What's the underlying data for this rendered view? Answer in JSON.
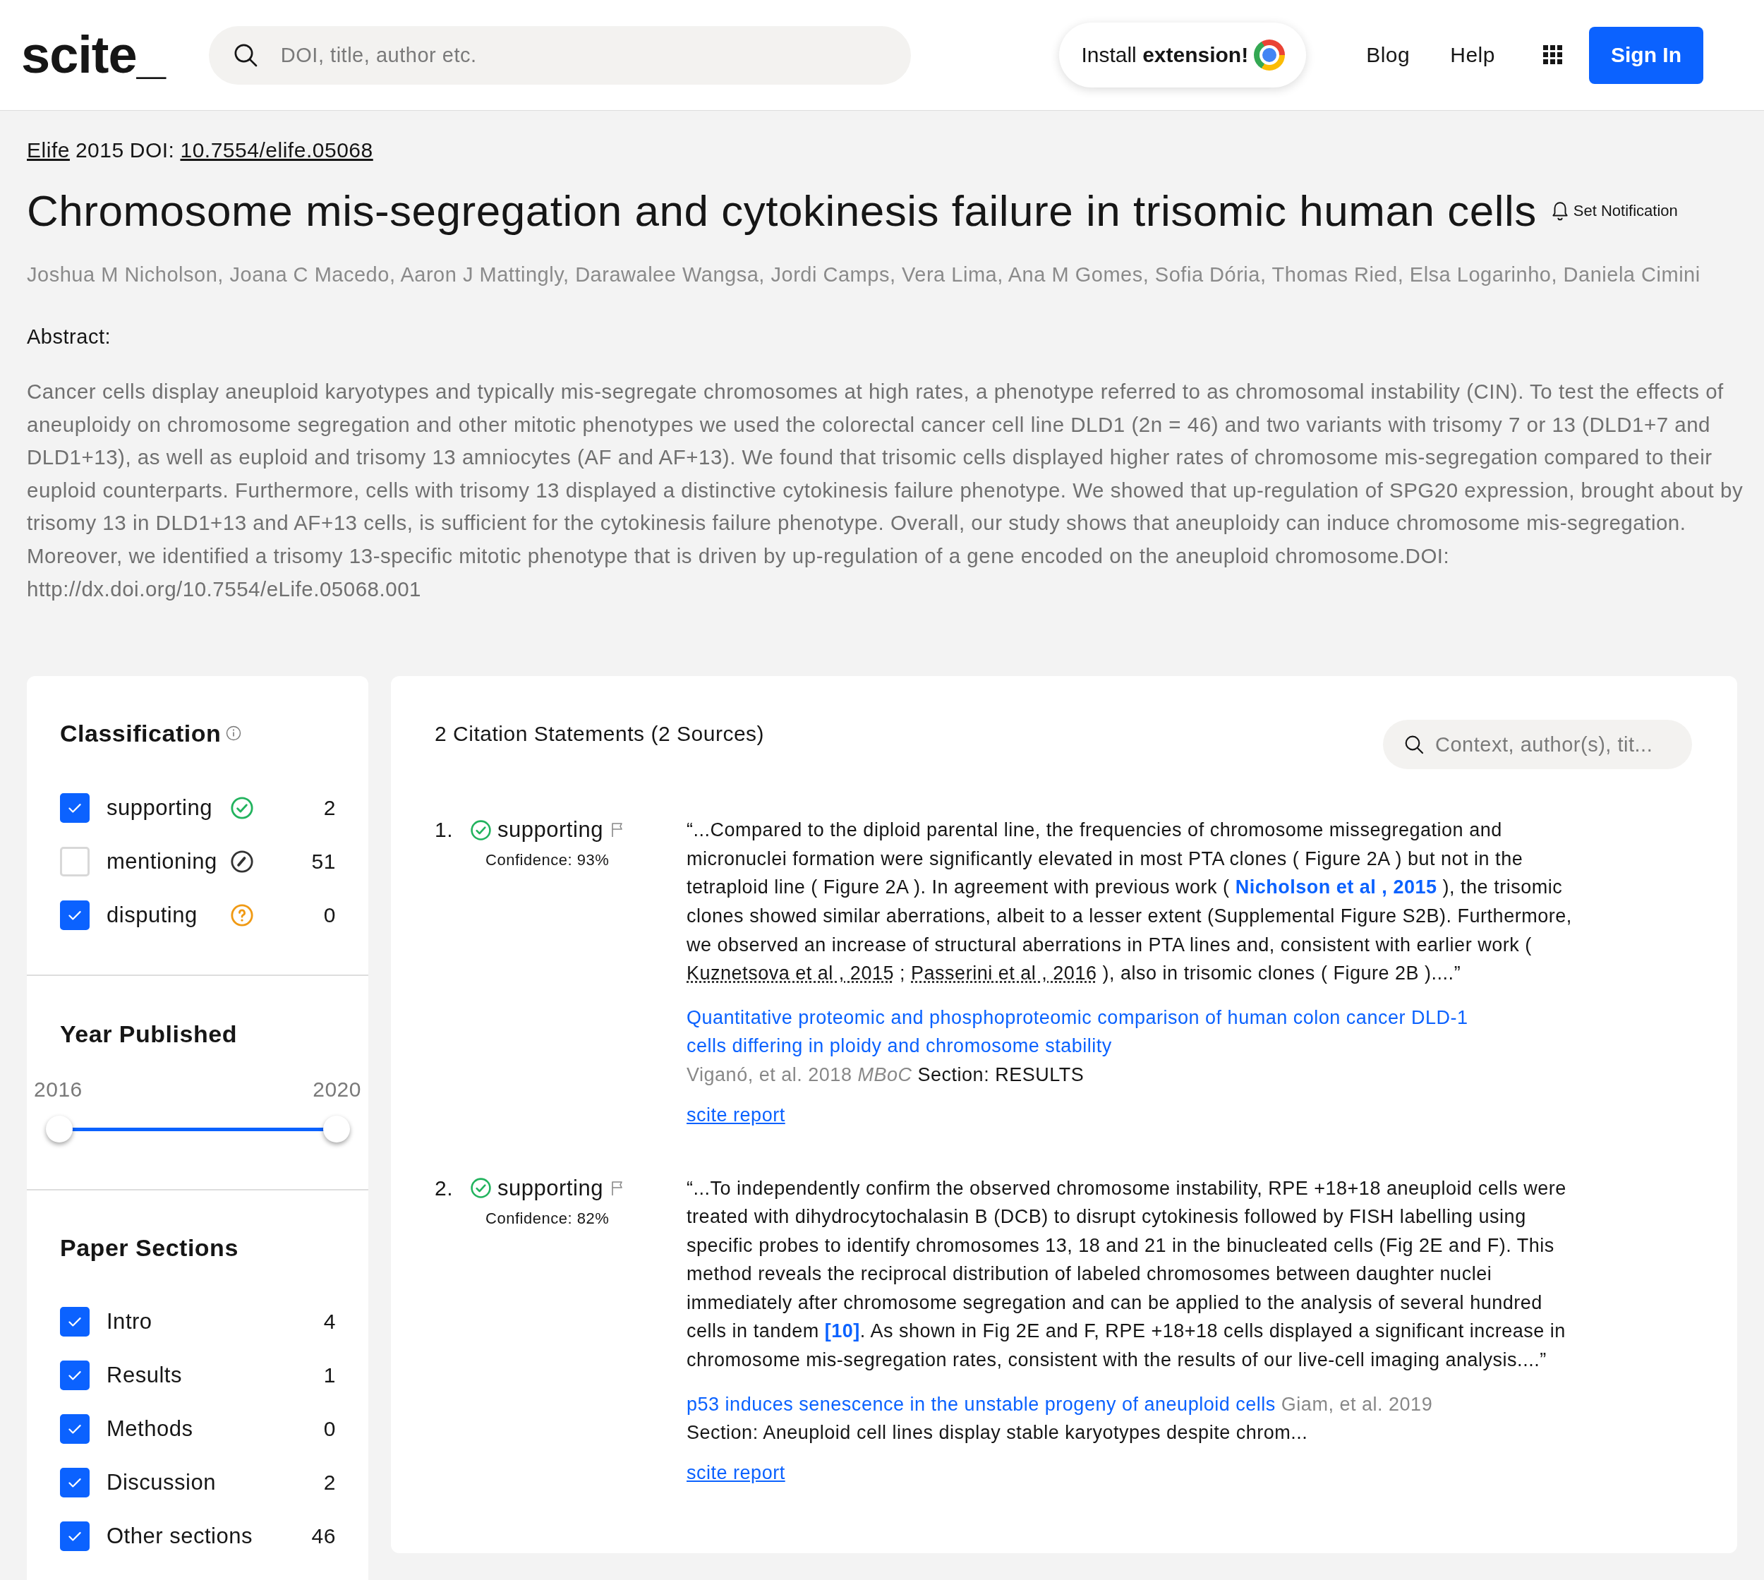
{
  "header": {
    "logo": "scite_",
    "search": {
      "placeholder": "DOI, title, author etc."
    },
    "install_button": "Install **extension!**",
    "nav": [
      "Blog",
      "Help"
    ],
    "sign_in": "Sign In"
  },
  "paper": {
    "journal_link": "Elife",
    "year": "2015",
    "doi_label": "DOI:",
    "doi_link": "10.7554/elife.05068",
    "title": "Chromosome mis-segregation and cytokinesis failure in trisomic human cells",
    "notification": "Set Notification",
    "authors": "Joshua M Nicholson, Joana C Macedo, Aaron J Mattingly, Darawalee Wangsa, Jordi Camps, Vera Lima, Ana M Gomes, Sofia Dória, Thomas Ried, Elsa Logarinho, Daniela Cimini",
    "abstract_label": "Abstract:",
    "abstract": "Cancer cells display aneuploid karyotypes and typically mis-segregate chromosomes at high rates, a phenotype referred to as chromosomal instability (CIN). To test the effects of aneuploidy on chromosome segregation and other mitotic phenotypes we used the colorectal cancer cell line DLD1 (2n = 46) and two variants with trisomy 7 or 13 (DLD1+7 and DLD1+13), as well as euploid and trisomy 13 amniocytes (AF and AF+13). We found that trisomic cells displayed higher rates of chromosome mis-segregation compared to their euploid counterparts. Furthermore, cells with trisomy 13 displayed a distinctive cytokinesis failure phenotype. We showed that up-regulation of SPG20 expression, brought about by trisomy 13 in DLD1+13 and AF+13 cells, is sufficient for the cytokinesis failure phenotype. Overall, our study shows that aneuploidy can induce chromosome mis-segregation. Moreover, we identified a trisomy 13-specific mitotic phenotype that is driven by up-regulation of a gene encoded on the aneuploid chromosome.DOI: http://dx.doi.org/10.7554/eLife.05068.001"
  },
  "filters": {
    "classification": {
      "title": "Classification",
      "items": [
        {
          "label": "supporting",
          "kind": "supporting",
          "checked": true,
          "count": "2"
        },
        {
          "label": "mentioning",
          "kind": "mentioning",
          "checked": false,
          "count": "51"
        },
        {
          "label": "disputing",
          "kind": "disputing",
          "checked": true,
          "count": "0"
        }
      ]
    },
    "year": {
      "title": "Year Published",
      "min_label": "2016",
      "max_label": "2020",
      "thumbs": [
        {
          "level": 0
        },
        {
          "level": 1
        }
      ]
    },
    "sections": {
      "title": "Paper Sections",
      "items": [
        {
          "label": "Intro",
          "checked": true,
          "count": "4"
        },
        {
          "label": "Results",
          "checked": true,
          "count": "1"
        },
        {
          "label": "Methods",
          "checked": true,
          "count": "0"
        },
        {
          "label": "Discussion",
          "checked": true,
          "count": "2"
        },
        {
          "label": "Other sections",
          "checked": true,
          "count": "46"
        }
      ]
    }
  },
  "citations": {
    "heading": "2 Citation Statements (2 Sources)",
    "search": {
      "placeholder": "Context, author(s), tit..."
    },
    "items": [
      {
        "number": "1.",
        "kind": "supporting",
        "label": "supporting",
        "confidence": "Confidence: 93%",
        "quote": [
          {
            "kind": "text",
            "text": "“...Compared to the diploid parental line, the frequencies of chromosome missegregation and micronuclei formation were significantly elevated in most PTA clones ( Figure 2A ) but not in the tetraploid line ( Figure 2A ). In agreement with previous work ( "
          },
          {
            "kind": "bold-link",
            "text": "Nicholson et al , 2015"
          },
          {
            "kind": "text",
            "text": " ), the trisomic clones showed similar aberrations, albeit to a lesser extent (Supplemental Figure S2B). Furthermore, we observed an increase of structural aberrations in PTA lines and, consistent with earlier work ( "
          },
          {
            "kind": "ref-link",
            "text": "Kuznetsova et al , 2015"
          },
          {
            "kind": "text",
            "text": " ; "
          },
          {
            "kind": "ref-link",
            "text": "Passerini et al , 2016"
          },
          {
            "kind": "text",
            "text": " ), also in trisomic clones ( Figure 2B )....”"
          }
        ],
        "source_title": "Quantitative proteomic and phosphoproteomic comparison of human colon cancer DLD-1 cells differing in ploidy and chromosome stability",
        "source_authors": "Viganó, et al. 2018",
        "journal": "MBoC",
        "section": "Section: RESULTS",
        "report": "scite report"
      },
      {
        "number": "2.",
        "kind": "supporting",
        "label": "supporting",
        "confidence": "Confidence: 82%",
        "quote": [
          {
            "kind": "text",
            "text": "“...To independently confirm the observed chromosome instability, RPE +18+18 aneuploid cells were treated with dihydrocytochalasin B (DCB) to disrupt cytokinesis followed by FISH labelling using specific probes to identify chromosomes 13, 18 and 21 in the binucleated cells (Fig 2E and F). This method reveals the reciprocal distribution of labeled chromosomes between daughter nuclei immediately after chromosome segregation and can be applied to the analysis of several hundred cells in tandem "
          },
          {
            "kind": "bold-link",
            "text": "[10]"
          },
          {
            "kind": "text",
            "text": ". As shown in Fig 2E and F, RPE +18+18 cells displayed a significant increase in chromosome mis-segregation rates, consistent with the results of our live-cell imaging analysis....”"
          }
        ],
        "source_title": "p53 induces senescence in the unstable progeny of aneuploid cells",
        "source_authors": "Giam, et al. 2019",
        "section": "Section: Aneuploid cell lines display stable karyotypes despite chrom...",
        "report": "scite report"
      }
    ]
  }
}
